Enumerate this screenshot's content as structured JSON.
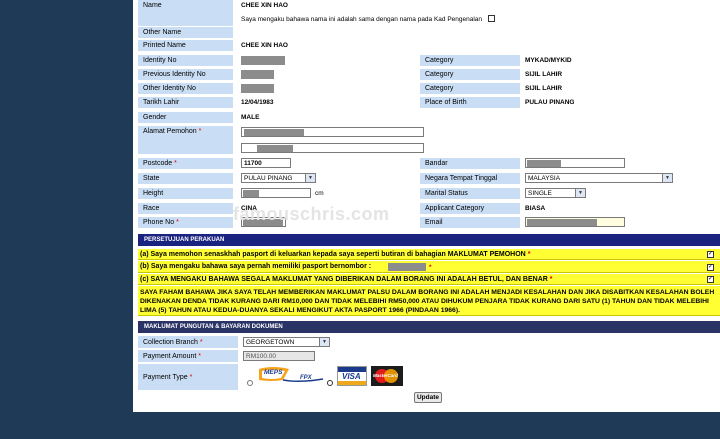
{
  "watermark": "famouschris.com",
  "personal": {
    "name_label": "Name",
    "name_value": "CHEE XIN HAO",
    "declaration": "Saya mengaku bahawa nama ini adalah sama dengan nama pada Kad Pengenalan",
    "other_name_label": "Other Name",
    "printed_name_label": "Printed Name",
    "printed_name_value": "CHEE XIN HAO",
    "identity_no_label": "Identity No",
    "previous_identity_label": "Previous Identity No",
    "other_identity_label": "Other Identity No",
    "tarikh_lahir_label": "Tarikh Lahir",
    "tarikh_lahir_value": "12/04/1983",
    "gender_label": "Gender",
    "gender_value": "MALE",
    "alamat_label": "Alamat Pemohon",
    "postcode_label": "Postcode",
    "postcode_value": "11700",
    "state_label": "State",
    "state_value": "PULAU PINANG",
    "height_label": "Height",
    "height_unit": "cm",
    "race_label": "Race",
    "race_value": "CINA",
    "phone_label": "Phone No",
    "category_label": "Category",
    "category_1": "MYKAD/MYKID",
    "category_2": "SIJIL LAHIR",
    "category_3": "SIJIL LAHIR",
    "place_of_birth_label": "Place of Birth",
    "place_of_birth_value": "PULAU PINANG",
    "bandar_label": "Bandar",
    "negara_label": "Negara Tempat Tinggal",
    "negara_value": "MALAYSIA",
    "marital_label": "Marital Status",
    "marital_value": "SINGLE",
    "applicant_category_label": "Applicant Category",
    "applicant_category_value": "BIASA",
    "email_label": "Email",
    "required_mark": "*"
  },
  "persetujuan": {
    "header": "PERSETUJUAN PERAKUAN",
    "item_a": "(a) Saya memohon senaskhah pasport di keluarkan kepada saya seperti butiran di bahagian MAKLUMAT PEMOHON",
    "item_b": "(b) Saya mengaku bahawa saya pernah memiliki pasport bernombor :",
    "item_c": "(c) SAYA MENGAKU BAHAWA SEGALA MAKLUMAT YANG DIBERIKAN DALAM BORANG INI ADALAH BETUL, DAN BENAR",
    "warning": "SAYA FAHAM BAHAWA JIKA SAYA TELAH MEMBERIKAN MAKLUMAT PALSU DALAM BORANG INI ADALAH MENJADI KESALAHAN DAN JIKA DISABITKAN KESALAHAN BOLEH DIKENAKAN DENDA TIDAK KURANG DARI RM10,000 DAN TIDAK MELEBIHI RM50,000 ATAU DIHUKUM PENJARA TIDAK KURANG DARI SATU (1) TAHUN DAN TIDAK MELEBIHI LIMA (5) TAHUN ATAU KEDUA-DUANYA SEKALI MENGIKUT AKTA PASPORT 1966 (PINDAAN 1966).",
    "check_mark": "✓"
  },
  "payment": {
    "header": "MAKLUMAT PUNGUTAN & BAYARAN DOKUMEN",
    "collection_label": "Collection Branch",
    "collection_value": "GEORGETOWN",
    "amount_label": "Payment Amount",
    "amount_value": "RM100.00",
    "type_label": "Payment Type",
    "meps_text": "MEPS",
    "fpx_text": "FPX",
    "visa_text": "VISA",
    "mastercard_text": "MasterCard"
  },
  "actions": {
    "update_label": "Update"
  },
  "colors": {
    "label_bg": "#c9ddf4",
    "section_bar": "#1a2380",
    "warning_bg": "#ffff33",
    "page_bg": "#1f3a57"
  }
}
